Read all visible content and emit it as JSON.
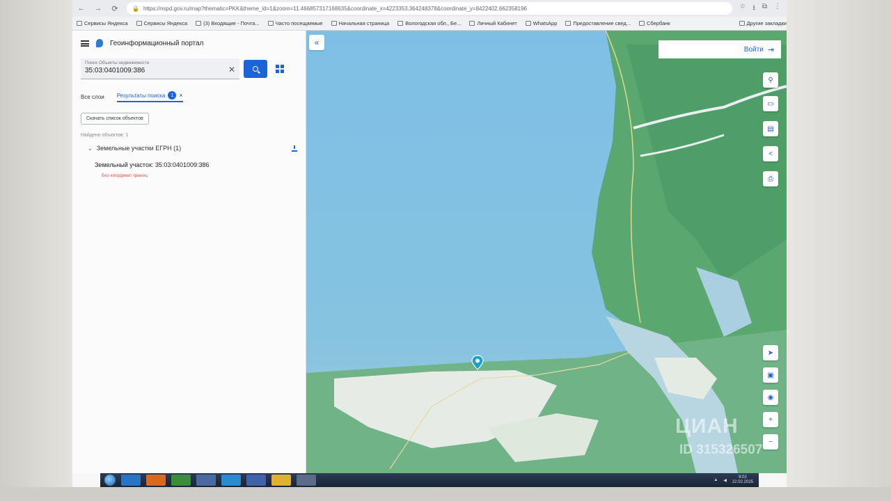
{
  "browser": {
    "url": "https://nspd.gov.ru/map?thematic=PKK&theme_id=1&zoom=11.466857317168635&coordinate_x=4223353.364248378&coordinate_y=8422402.662358196",
    "host": "nspd.gov.ru",
    "bookmarks": [
      "Сервисы Яндекса",
      "Сервисы Яндекса",
      "(3) Входящие - Почта...",
      "Часто посещаемые",
      "Начальная страница",
      "Вологодская обл., Бе...",
      "Личный Кабинет",
      "WhatsApp",
      "Предоставление свед...",
      "Сбербанк"
    ],
    "other_bookmarks": "Другие закладки"
  },
  "portal": {
    "title": "Геоинформационный портал"
  },
  "search": {
    "caption": "Поиск Объекты недвижимости",
    "value": "35:03:0401009:386"
  },
  "tabs": {
    "all_layers": "Все слои",
    "results": "Результаты поиска",
    "results_count": "1"
  },
  "results": {
    "download_list": "Скачать список объектов",
    "found": "Найдено объектов: 1",
    "group_title": "Земельные участки ЕГРН (1)",
    "parcel": "Земельный участок: 35:03:0401009:386",
    "parcel_note": "Без координат границ"
  },
  "map": {
    "login": "Войти",
    "watermark": "ЦИАН",
    "watermark_id": "ID 315326507"
  },
  "taskbar": {
    "time": "9:02",
    "date": "22.02.2025"
  }
}
